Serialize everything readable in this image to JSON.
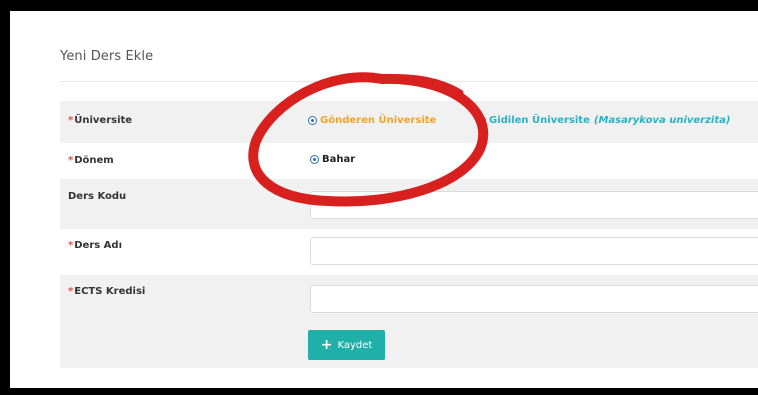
{
  "form": {
    "title": "Yeni Ders Ekle",
    "required_marker": "*",
    "university": {
      "label": "Üniversite",
      "option_sending": "Gönderen Üniversite",
      "option_receiving": "Gidilen Üniversite",
      "option_receiving_detail": "(Masarykova univerzita)",
      "selected": "Gönderen Üniversite"
    },
    "term": {
      "label": "Dönem",
      "option": "Bahar"
    },
    "course_code": {
      "label": "Ders Kodu",
      "value": ""
    },
    "course_name": {
      "label": "Ders Adı",
      "value": ""
    },
    "ects": {
      "label": "ECTS Kredisi",
      "value": ""
    },
    "save_label": "Kaydet"
  },
  "colors": {
    "accent": "#1fb0aa",
    "highlight_circle": "#d8201f",
    "sending_option": "#f2a32a",
    "receiving_option": "#28b3c4"
  }
}
